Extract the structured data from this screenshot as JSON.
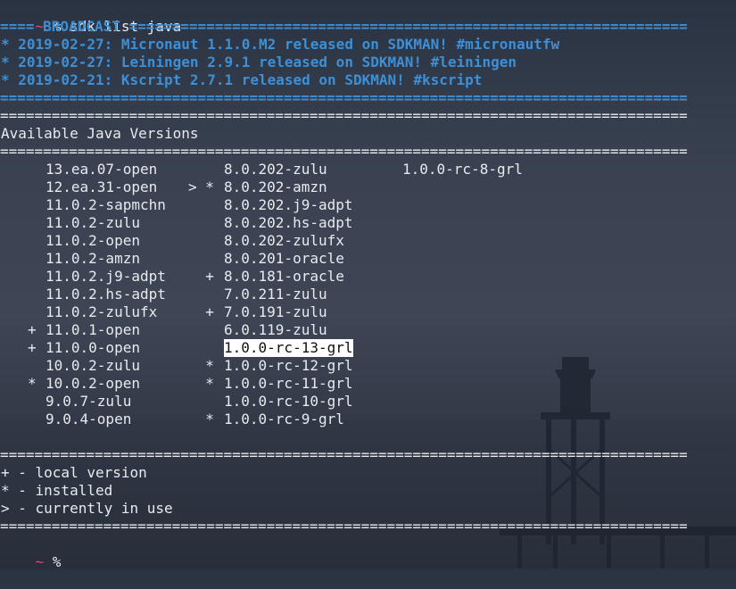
{
  "prompt": {
    "symbol": "~",
    "cmd": " % sdk list java",
    "tail": " %"
  },
  "broadcast": {
    "header": "==== BROADCAST =================================================================",
    "items": [
      "* 2019-02-27: Micronaut 1.1.0.M2 released on SDKMAN! #micronautfw",
      "* 2019-02-27: Leiningen 2.9.1 released on SDKMAN! #leiningen",
      "* 2019-02-21: Kscript 2.7.1 released on SDKMAN! #kscript"
    ],
    "footer": "================================================================================"
  },
  "separator": "================================================================================",
  "title": "Available Java Versions",
  "versions": {
    "col1": [
      {
        "mark": " ",
        "ver": "13.ea.07-open"
      },
      {
        "mark": " ",
        "ver": "12.ea.31-open"
      },
      {
        "mark": " ",
        "ver": "11.0.2-sapmchn"
      },
      {
        "mark": " ",
        "ver": "11.0.2-zulu"
      },
      {
        "mark": " ",
        "ver": "11.0.2-open"
      },
      {
        "mark": " ",
        "ver": "11.0.2-amzn"
      },
      {
        "mark": " ",
        "ver": "11.0.2.j9-adpt"
      },
      {
        "mark": " ",
        "ver": "11.0.2.hs-adpt"
      },
      {
        "mark": " ",
        "ver": "11.0.2-zulufx"
      },
      {
        "mark": "+",
        "ver": "11.0.1-open"
      },
      {
        "mark": "+",
        "ver": "11.0.0-open"
      },
      {
        "mark": " ",
        "ver": "10.0.2-zulu"
      },
      {
        "mark": "*",
        "ver": "10.0.2-open"
      },
      {
        "mark": " ",
        "ver": "9.0.7-zulu"
      },
      {
        "mark": " ",
        "ver": "9.0.4-open"
      }
    ],
    "col2": [
      {
        "mark": "   ",
        "ver": "8.0.202-zulu"
      },
      {
        "mark": "> *",
        "ver": "8.0.202-amzn"
      },
      {
        "mark": "   ",
        "ver": "8.0.202.j9-adpt"
      },
      {
        "mark": "   ",
        "ver": "8.0.202.hs-adpt"
      },
      {
        "mark": "   ",
        "ver": "8.0.202-zulufx"
      },
      {
        "mark": "   ",
        "ver": "8.0.201-oracle"
      },
      {
        "mark": "  +",
        "ver": "8.0.181-oracle"
      },
      {
        "mark": "   ",
        "ver": "7.0.211-zulu"
      },
      {
        "mark": "  +",
        "ver": "7.0.191-zulu"
      },
      {
        "mark": "   ",
        "ver": "6.0.119-zulu"
      },
      {
        "mark": "   ",
        "ver": "1.0.0-rc-13-grl"
      },
      {
        "mark": "  *",
        "ver": "1.0.0-rc-12-grl"
      },
      {
        "mark": "  *",
        "ver": "1.0.0-rc-11-grl"
      },
      {
        "mark": "   ",
        "ver": "1.0.0-rc-10-grl"
      },
      {
        "mark": "  *",
        "ver": "1.0.0-rc-9-grl"
      }
    ],
    "col3": [
      {
        "mark": " ",
        "ver": "1.0.0-rc-8-grl"
      }
    ]
  },
  "legend": [
    "+ - local version",
    "* - installed",
    "> - currently in use"
  ],
  "colors": {
    "accent_blue": "#3d8fd6",
    "prompt_pink": "#e0457b",
    "text": "#e8eaee"
  }
}
